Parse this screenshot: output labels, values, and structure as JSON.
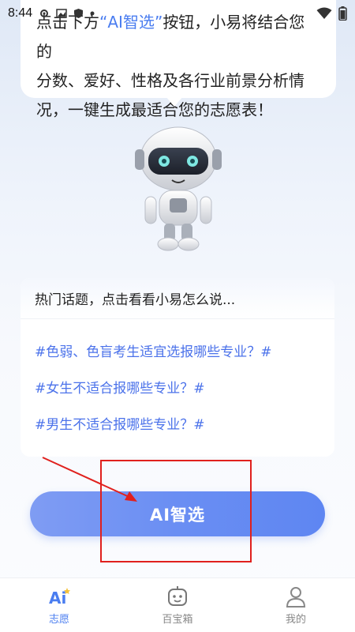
{
  "status_bar": {
    "time": "8:44",
    "left_icons": [
      "gear-icon",
      "photo-icon",
      "shield-icon",
      "dot-icon"
    ],
    "right_icons": [
      "wifi-icon",
      "battery-icon"
    ]
  },
  "bubble": {
    "line1_before": "点击下方",
    "line1_highlight": "“AI智选”",
    "line1_after": "按钮，小易将结合您的",
    "line2": "分数、爱好、性格及各行业前景分析情",
    "line3": "况，一键生成最适合您的志愿表！"
  },
  "topics": {
    "heading": "热门话题，点击看看小易怎么说...",
    "items": [
      {
        "label": "#色弱、色盲考生适宜选报哪些专业？#"
      },
      {
        "label": "#女生不适合报哪些专业？#"
      },
      {
        "label": "#男生不适合报哪些专业？#"
      }
    ]
  },
  "ai_button": {
    "label": "AI智选"
  },
  "bottom_nav": {
    "items": [
      {
        "label": "志愿",
        "icon": "ai-icon",
        "active": true
      },
      {
        "label": "百宝箱",
        "icon": "robot-face-icon",
        "active": false
      },
      {
        "label": "我的",
        "icon": "person-icon",
        "active": false
      }
    ]
  },
  "colors": {
    "accent": "#4a7df0",
    "button_gradient_start": "#7f9cf3",
    "button_gradient_end": "#5e86f2",
    "annotation": "#e0201d"
  }
}
